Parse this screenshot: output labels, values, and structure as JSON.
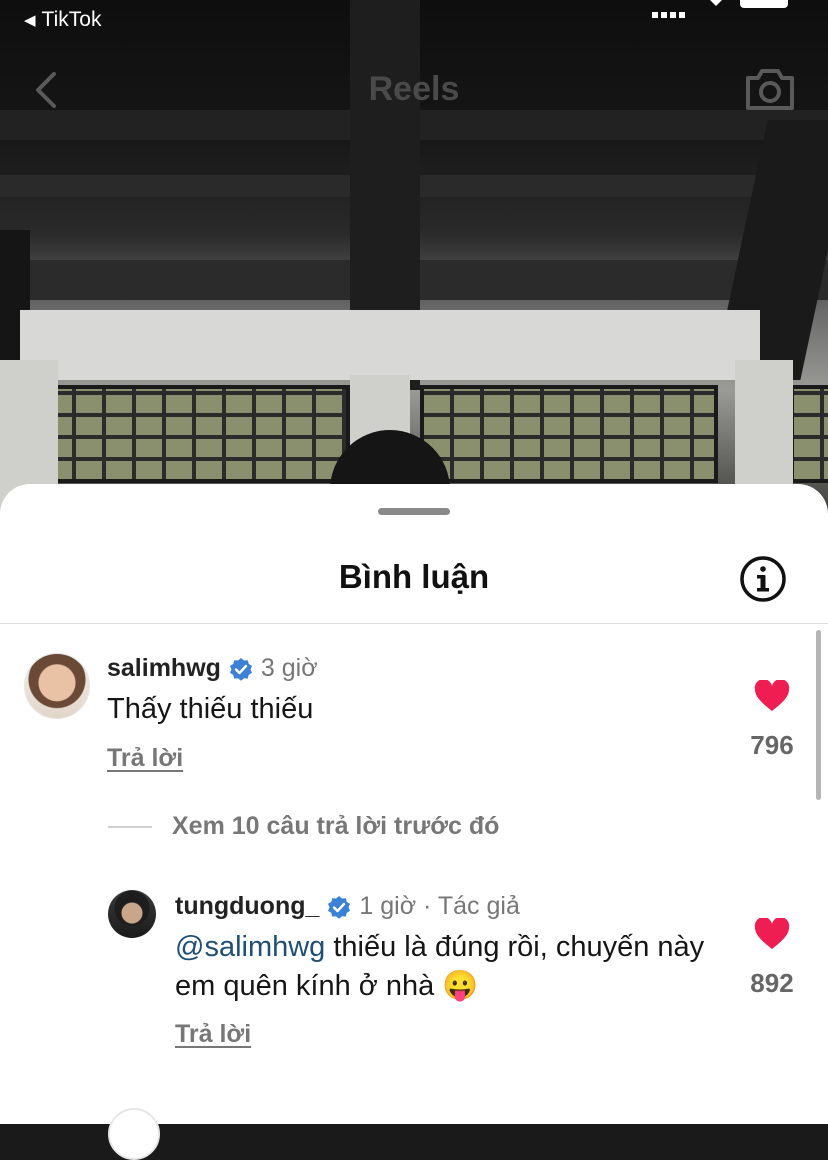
{
  "status_bar": {
    "back_app": "TikTok"
  },
  "nav": {
    "title": "Reels"
  },
  "comments_sheet": {
    "title": "Bình luận",
    "comments": [
      {
        "username": "salimhwg",
        "verified": true,
        "time": "3 giờ",
        "text": "Thấy thiếu thiếu",
        "reply_label": "Trả lời",
        "likes": "796"
      }
    ],
    "view_more": "Xem 10 câu trả lời trước đó",
    "replies": [
      {
        "username": "tungduong_",
        "verified": true,
        "time": "1 giờ · Tác giả",
        "mention": "@salimhwg",
        "text": " thiếu là đúng rồi, chuyến này em quên kính ở nhà 😛",
        "reply_label": "Trả lời",
        "likes": "892"
      }
    ]
  },
  "colors": {
    "heart": "#ee1d52",
    "verified": "#3b82d6",
    "mention": "#1f4f74"
  }
}
